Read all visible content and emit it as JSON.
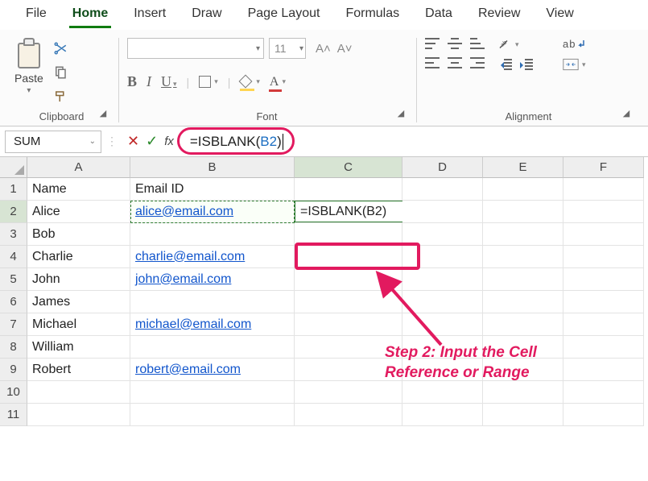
{
  "menu": {
    "items": [
      "File",
      "Home",
      "Insert",
      "Draw",
      "Page Layout",
      "Formulas",
      "Data",
      "Review",
      "View"
    ],
    "active_index": 1
  },
  "ribbon": {
    "clipboard": {
      "paste_label": "Paste",
      "group_label": "Clipboard"
    },
    "font": {
      "group_label": "Font",
      "size_value": "11",
      "grow_label": "A˄",
      "shrink_label": "A˅",
      "bold": "B",
      "italic": "I",
      "underline": "U",
      "font_color_letter": "A"
    },
    "alignment": {
      "group_label": "Alignment",
      "wrap_label": "ab"
    }
  },
  "formula_bar": {
    "name_box": "SUM",
    "fx_label": "fx",
    "formula_prefix": "=ISBLANK(",
    "formula_ref": "B2",
    "formula_suffix": ")"
  },
  "grid": {
    "col_labels": [
      "A",
      "B",
      "C",
      "D",
      "E",
      "F"
    ],
    "row_labels": [
      "1",
      "2",
      "3",
      "4",
      "5",
      "6",
      "7",
      "8",
      "9",
      "10",
      "11"
    ],
    "headers": {
      "A": "Name",
      "B": "Email ID"
    },
    "rows": [
      {
        "name": "Alice",
        "email": "alice@email.com"
      },
      {
        "name": "Bob",
        "email": ""
      },
      {
        "name": "Charlie",
        "email": "charlie@email.com"
      },
      {
        "name": "John",
        "email": "john@email.com"
      },
      {
        "name": "James",
        "email": ""
      },
      {
        "name": "Michael",
        "email": "michael@email.com"
      },
      {
        "name": "William",
        "email": ""
      },
      {
        "name": "Robert",
        "email": "robert@email.com"
      }
    ],
    "c2_display": "=ISBLANK(B2)"
  },
  "annotation": {
    "step_text_line1": "Step 2: Input the Cell",
    "step_text_line2": "Reference or Range"
  }
}
